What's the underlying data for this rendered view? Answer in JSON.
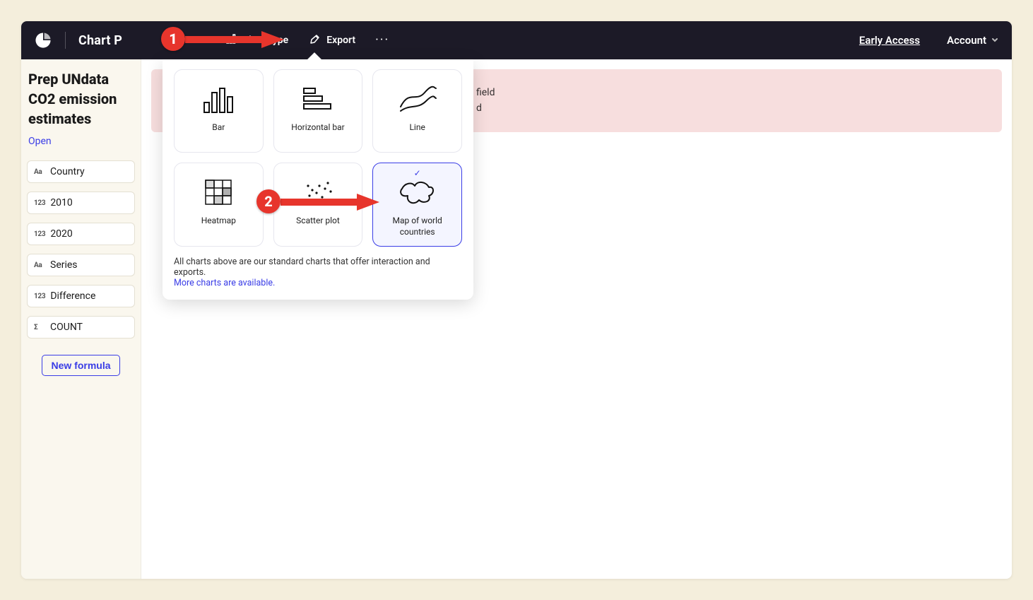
{
  "header": {
    "chart_title": "Chart P",
    "nav": {
      "chart_type": "Chart type",
      "export": "Export"
    },
    "early_access": "Early Access",
    "account": "Account"
  },
  "sidebar": {
    "title": "Prep UNdata CO2 emission estimates",
    "open": "Open",
    "fields": [
      {
        "icon": "Aa",
        "label": "Country"
      },
      {
        "icon": "123",
        "label": "2010"
      },
      {
        "icon": "123",
        "label": "2020"
      },
      {
        "icon": "Aa",
        "label": "Series"
      },
      {
        "icon": "123",
        "label": "Difference"
      },
      {
        "icon": "Σ",
        "label": "COUNT"
      }
    ],
    "new_formula": "New formula"
  },
  "main": {
    "error_line1": "field",
    "error_line2": "d"
  },
  "dropdown": {
    "options": [
      {
        "id": "bar",
        "label": "Bar",
        "selected": false
      },
      {
        "id": "hbar",
        "label": "Horizontal bar",
        "selected": false
      },
      {
        "id": "line",
        "label": "Line",
        "selected": false
      },
      {
        "id": "heatmap",
        "label": "Heatmap",
        "selected": false
      },
      {
        "id": "scatter",
        "label": "Scatter plot",
        "selected": false
      },
      {
        "id": "worldmap",
        "label": "Map of world countries",
        "selected": true
      }
    ],
    "footer_text": "All charts above are our standard charts that offer interaction and exports.",
    "footer_link": "More charts are available."
  },
  "annotations": {
    "badge1": "1",
    "badge2": "2"
  }
}
